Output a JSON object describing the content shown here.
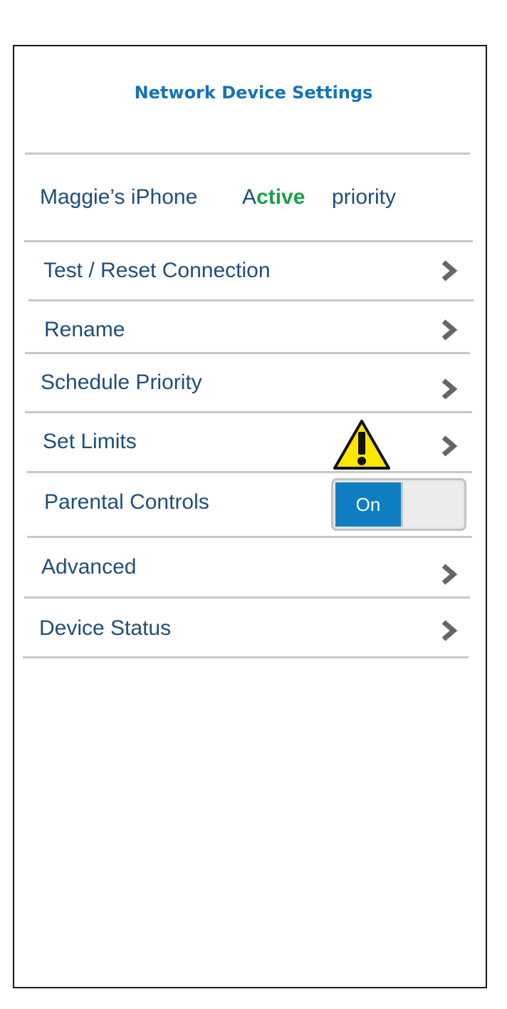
{
  "header": {
    "title": "Network Device Settings"
  },
  "device": {
    "name": "Maggie’s iPhone",
    "status_first_letter": "A",
    "status_rest": "ctive",
    "priority_label": "priority"
  },
  "menu": {
    "test_reset": "Test / Reset Connection",
    "rename": "Rename",
    "schedule_priority": "Schedule Priority",
    "set_limits": "Set Limits",
    "parental_controls": "Parental Controls",
    "parental_toggle_label": "On",
    "advanced": "Advanced",
    "device_status": "Device Status"
  },
  "icons": {
    "chevron": "chevron-right-icon",
    "warning": "warning-icon"
  },
  "colors": {
    "title": "#1472b9",
    "label": "#1f4e79",
    "active": "#17a04a",
    "toggle_on": "#0f7dc2",
    "chevron": "#666666",
    "warning": "#ffe600"
  }
}
